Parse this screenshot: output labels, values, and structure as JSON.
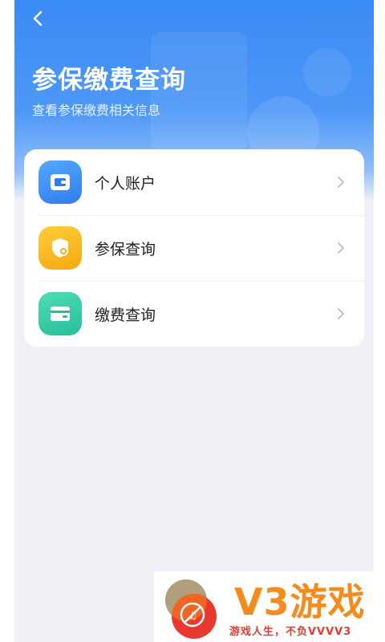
{
  "header": {
    "title": "参保缴费查询",
    "subtitle": "查看参保缴费相关信息"
  },
  "menu": {
    "items": [
      {
        "label": "个人账户",
        "icon": "wallet-icon",
        "color_from": "#55a8ff",
        "color_to": "#2f7df0"
      },
      {
        "label": "参保查询",
        "icon": "shield-search-icon",
        "color_from": "#ffcc3a",
        "color_to": "#f5a90e"
      },
      {
        "label": "缴费查询",
        "icon": "card-icon",
        "color_from": "#4fdcb8",
        "color_to": "#26bf98"
      }
    ]
  },
  "watermark": {
    "brand": "V3游戏",
    "slogan": "游戏人生，不负VVVV3"
  },
  "colors": {
    "header_blue": "#3a8bf5",
    "background": "#f0f1f6",
    "brand_orange": "#f58a1f",
    "slogan_red": "#e8392f"
  }
}
